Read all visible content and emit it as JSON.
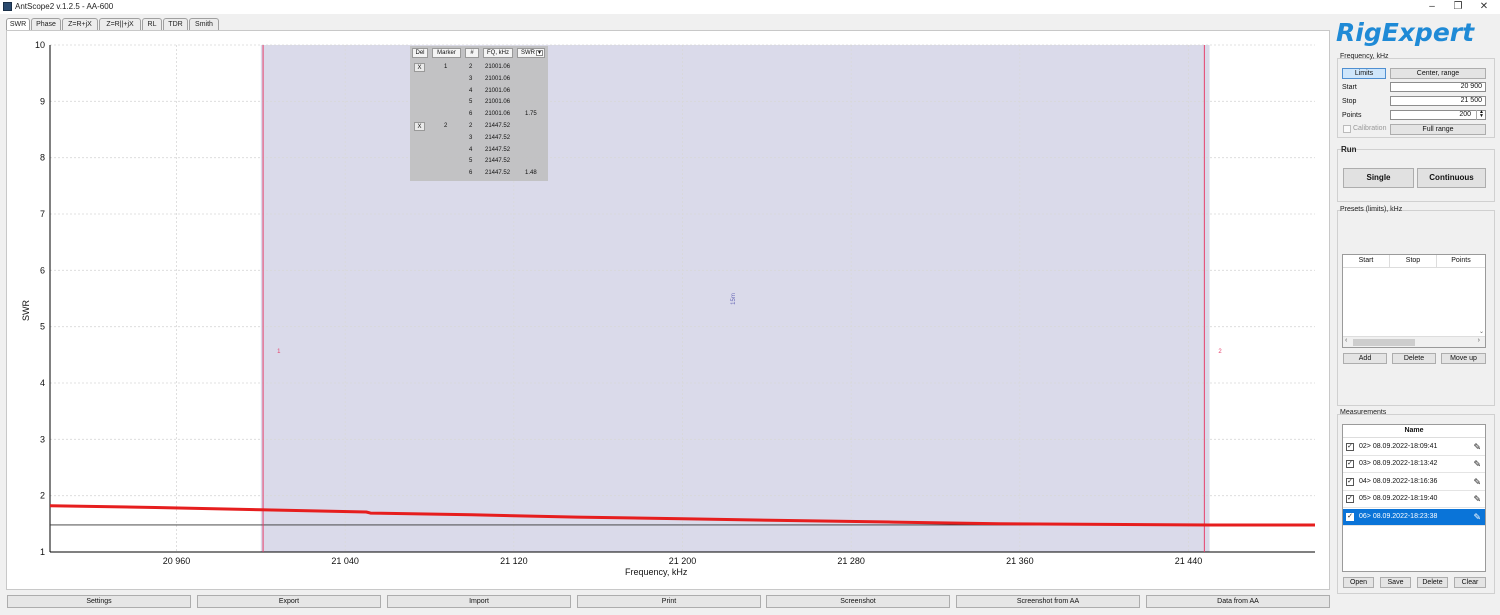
{
  "window": {
    "title": "AntScope2 v.1.2.5 - AA-600",
    "minimize": "–",
    "restore": "❐",
    "close": "✕"
  },
  "tabs": [
    "SWR",
    "Phase",
    "Z=R+jX",
    "Z=R||+jX",
    "RL",
    "TDR",
    "Smith"
  ],
  "active_tab": "SWR",
  "marker_table": {
    "headers": [
      "Del",
      "Marker",
      "#",
      "FQ, kHz",
      "SWR"
    ],
    "del_label": "X",
    "rows": [
      {
        "del": "X",
        "marker": "1",
        "num": "2",
        "fq": "21001.06",
        "swr": ""
      },
      {
        "del": "",
        "marker": "",
        "num": "3",
        "fq": "21001.06",
        "swr": ""
      },
      {
        "del": "",
        "marker": "",
        "num": "4",
        "fq": "21001.06",
        "swr": ""
      },
      {
        "del": "",
        "marker": "",
        "num": "5",
        "fq": "21001.06",
        "swr": ""
      },
      {
        "del": "",
        "marker": "",
        "num": "6",
        "fq": "21001.06",
        "swr": "1.75"
      },
      {
        "del": "X",
        "marker": "2",
        "num": "2",
        "fq": "21447.52",
        "swr": ""
      },
      {
        "del": "",
        "marker": "",
        "num": "3",
        "fq": "21447.52",
        "swr": ""
      },
      {
        "del": "",
        "marker": "",
        "num": "4",
        "fq": "21447.52",
        "swr": ""
      },
      {
        "del": "",
        "marker": "",
        "num": "5",
        "fq": "21447.52",
        "swr": ""
      },
      {
        "del": "",
        "marker": "",
        "num": "6",
        "fq": "21447.52",
        "swr": "1.48"
      }
    ]
  },
  "chart_data": {
    "type": "line",
    "xlabel": "Frequency, kHz",
    "ylabel": "SWR",
    "xlim": [
      20900,
      21500
    ],
    "ylim": [
      1,
      10
    ],
    "xticks": [
      20960,
      21040,
      21120,
      21200,
      21280,
      21360,
      21440
    ],
    "xtick_labels": [
      "20 960",
      "21 040",
      "21 120",
      "21 200",
      "21 280",
      "21 360",
      "21 440"
    ],
    "yticks": [
      1,
      2,
      3,
      4,
      5,
      6,
      7,
      8,
      9,
      10
    ],
    "grid": true,
    "band": {
      "start": 21000,
      "end": 21450,
      "label": "15m",
      "color": "#dadaea"
    },
    "markers": [
      {
        "label": "1",
        "x": 21001.06
      },
      {
        "label": "2",
        "x": 21447.52
      }
    ],
    "reference_line": 1.48,
    "series": [
      {
        "color": "#e61e1e",
        "x": [
          20900,
          20950,
          21000,
          21050,
          21052,
          21100,
          21150,
          21200,
          21250,
          21300,
          21350,
          21400,
          21450,
          21500
        ],
        "y": [
          1.82,
          1.79,
          1.75,
          1.71,
          1.69,
          1.66,
          1.62,
          1.59,
          1.56,
          1.53,
          1.5,
          1.49,
          1.48,
          1.48
        ]
      }
    ],
    "colors": {
      "grid": "#d8d8d8",
      "marker": "#e6406c",
      "ref": "#333333",
      "band_label": "#6a6ab8"
    }
  },
  "bottom_buttons": [
    "Settings",
    "Export",
    "Import",
    "Print",
    "Screenshot",
    "Screenshot from AA",
    "Data from AA"
  ],
  "sidebar": {
    "logo": "RigExpert",
    "frequency": {
      "title": "Frequency, kHz",
      "limits_btn": "Limits",
      "center_btn": "Center, range",
      "start_label": "Start",
      "start_value": "20 900",
      "stop_label": "Stop",
      "stop_value": "21 500",
      "points_label": "Points",
      "points_value": "200",
      "calibration_label": "Calibration",
      "full_range_btn": "Full range"
    },
    "run": {
      "title": "Run",
      "single_btn": "Single",
      "continuous_btn": "Continuous"
    },
    "presets": {
      "title": "Presets (limits), kHz",
      "headers": [
        "Start",
        "Stop",
        "Points"
      ],
      "add_btn": "Add",
      "delete_btn": "Delete",
      "move_up_btn": "Move up"
    },
    "measurements": {
      "title": "Measurements",
      "header": "Name",
      "rows": [
        {
          "name": "02> 08.09.2022-18:09:41",
          "checked": true,
          "selected": false
        },
        {
          "name": "03> 08.09.2022-18:13:42",
          "checked": true,
          "selected": false
        },
        {
          "name": "04> 08.09.2022-18:16:36",
          "checked": true,
          "selected": false
        },
        {
          "name": "05> 08.09.2022-18:19:40",
          "checked": true,
          "selected": false
        },
        {
          "name": "06> 08.09.2022-18:23:38",
          "checked": true,
          "selected": true
        }
      ],
      "open_btn": "Open",
      "save_btn": "Save",
      "delete_btn": "Delete",
      "clear_btn": "Clear"
    }
  }
}
